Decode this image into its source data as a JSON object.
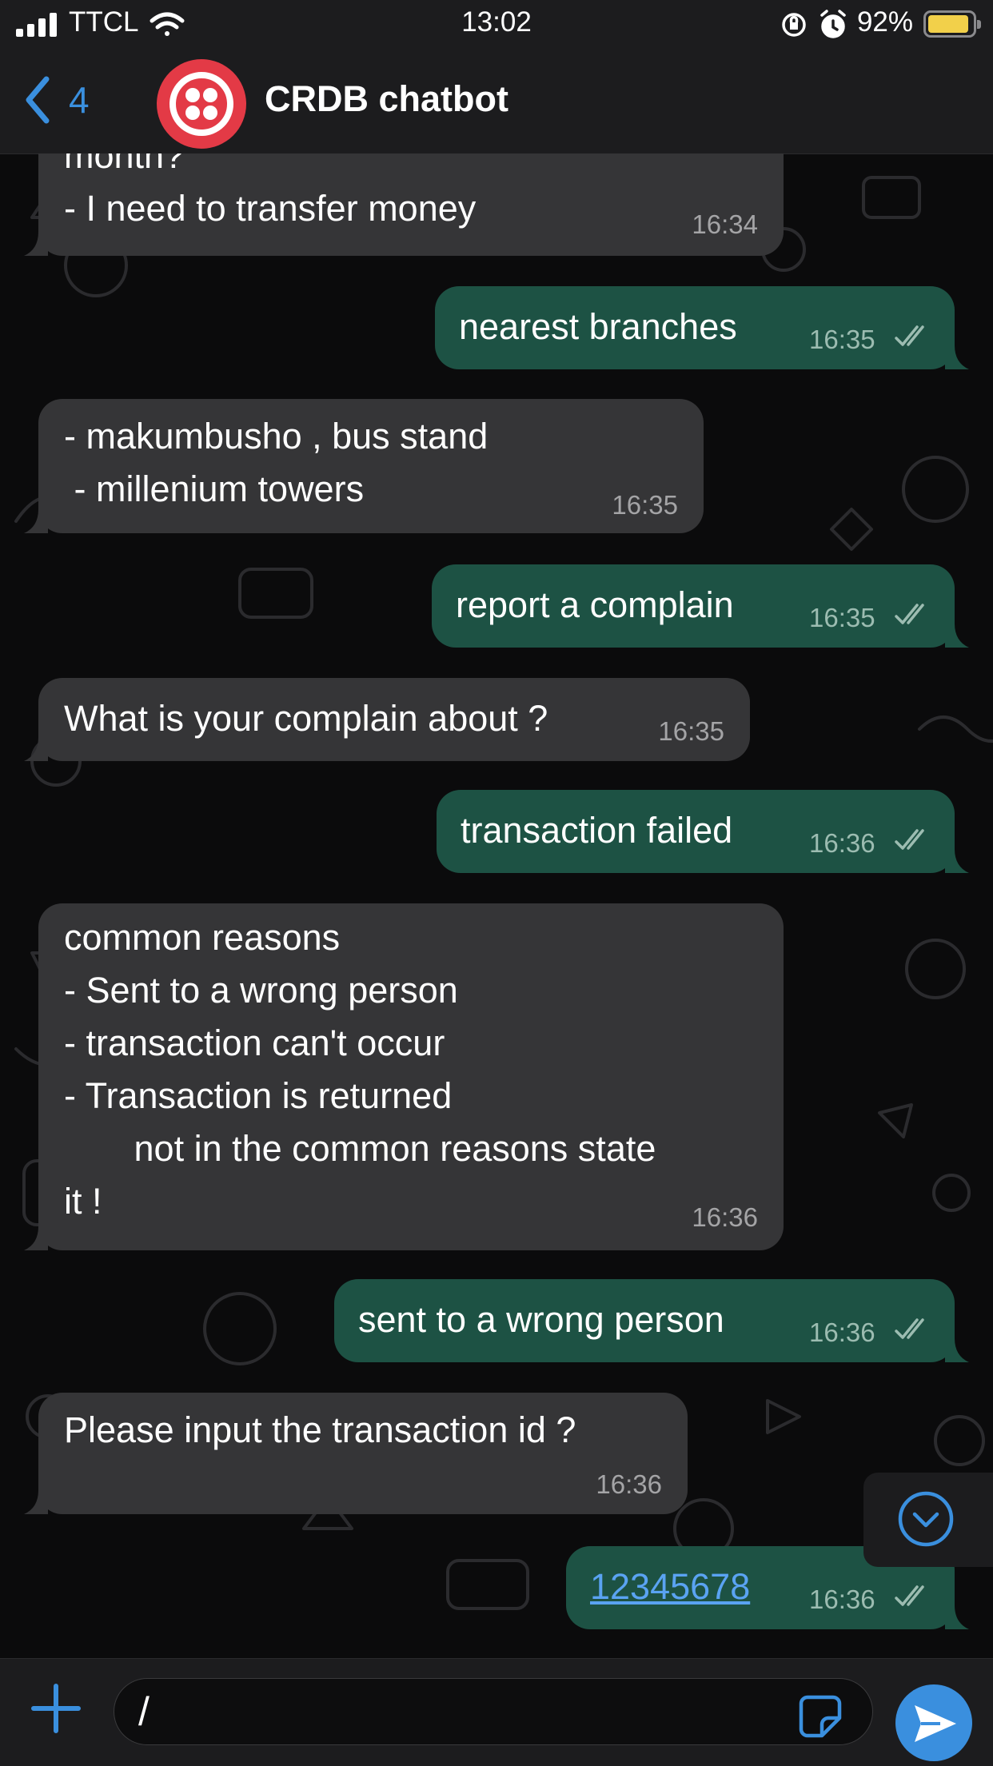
{
  "status_bar": {
    "carrier": "TTCL",
    "time": "13:02",
    "battery_percent": "92%",
    "battery_level": 0.92,
    "icons": [
      "signal-icon",
      "wifi-icon",
      "rotation-lock-icon",
      "alarm-icon",
      "battery-icon"
    ]
  },
  "header": {
    "back_count": "4",
    "title": "CRDB chatbot",
    "avatar_icon": "twilio-logo-icon",
    "avatar_color": "#e33a46"
  },
  "messages": [
    {
      "direction": "in",
      "lines": [
        "month?",
        "- I need to transfer money"
      ],
      "time": "16:34"
    },
    {
      "direction": "out",
      "lines": [
        "nearest branches"
      ],
      "time": "16:35",
      "status": "read"
    },
    {
      "direction": "in",
      "lines": [
        "- makumbusho , bus stand",
        " - millenium towers"
      ],
      "time": "16:35"
    },
    {
      "direction": "out",
      "lines": [
        "report a complain"
      ],
      "time": "16:35",
      "status": "read"
    },
    {
      "direction": "in",
      "lines": [
        "What is your complain about ?"
      ],
      "time": "16:35"
    },
    {
      "direction": "out",
      "lines": [
        "transaction failed"
      ],
      "time": "16:36",
      "status": "read"
    },
    {
      "direction": "in",
      "lines": [
        "common reasons",
        "- Sent to a wrong person",
        "- transaction can't occur",
        "- Transaction is returned",
        "       not in the common reasons state",
        "it !"
      ],
      "time": "16:36"
    },
    {
      "direction": "out",
      "lines": [
        "sent to a wrong person"
      ],
      "time": "16:36",
      "status": "read"
    },
    {
      "direction": "in",
      "lines": [
        "Please input the transaction id ?"
      ],
      "time": "16:36"
    },
    {
      "direction": "out",
      "lines": [
        "12345678"
      ],
      "time": "16:36",
      "status": "read",
      "link": true
    }
  ],
  "input": {
    "value": "/"
  },
  "colors": {
    "accent": "#3a8fde",
    "incoming_bubble": "#353537",
    "outgoing_bubble": "#1d5244"
  }
}
